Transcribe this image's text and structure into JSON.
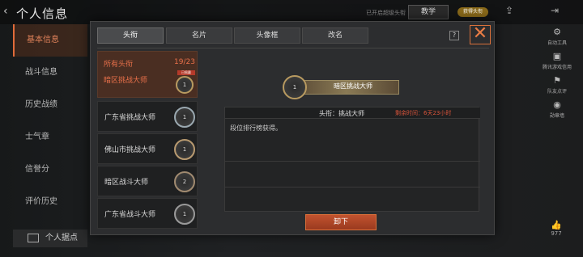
{
  "header": {
    "back_icon": "back-arrow-icon",
    "title": "个人信息",
    "hint": "已开启超级头衔",
    "teach_label": "教学",
    "coin_label": "获得头衔"
  },
  "nav": {
    "items": [
      {
        "label": "基本信息",
        "active": true
      },
      {
        "label": "战斗信息",
        "active": false
      },
      {
        "label": "历史战绩",
        "active": false
      },
      {
        "label": "士气章",
        "active": false
      },
      {
        "label": "信誉分",
        "active": false
      },
      {
        "label": "评价历史",
        "active": false
      }
    ],
    "bottom_label": "个人据点"
  },
  "right_bar": {
    "items": [
      {
        "icon": "gear-icon",
        "label": "自动工具"
      },
      {
        "icon": "lock-icon",
        "label": "腾讯游戏信用"
      },
      {
        "icon": "flag-icon",
        "label": "队友点评"
      },
      {
        "icon": "medal-icon",
        "label": "勋章墙"
      }
    ],
    "like_count": "977"
  },
  "dialog": {
    "tabs": [
      "头衔",
      "名片",
      "头像框",
      "改名"
    ],
    "active_tab": 0,
    "help": "?",
    "list": {
      "header_label": "所有头衔",
      "count": "19/23",
      "equipped_title": "暗区挑战大师",
      "equipped_tag": "已佩戴",
      "items": [
        {
          "title": "广东省挑战大师",
          "rank": "1"
        },
        {
          "title": "佛山市挑战大师",
          "rank": "1"
        },
        {
          "title": "暗区战斗大师",
          "rank": "2"
        },
        {
          "title": "广东省战斗大师",
          "rank": "1"
        }
      ],
      "equipped_rank": "1"
    },
    "detail": {
      "banner_title": "暗区挑战大师",
      "banner_rank": "1",
      "label": "头衔：挑战大师",
      "remaining": "剩余时间：6天23小时",
      "description": "段位排行榜获得。",
      "unequip_label": "卸下"
    }
  },
  "colors": {
    "accent": "#e06b3a",
    "remain": "#d9543a"
  }
}
